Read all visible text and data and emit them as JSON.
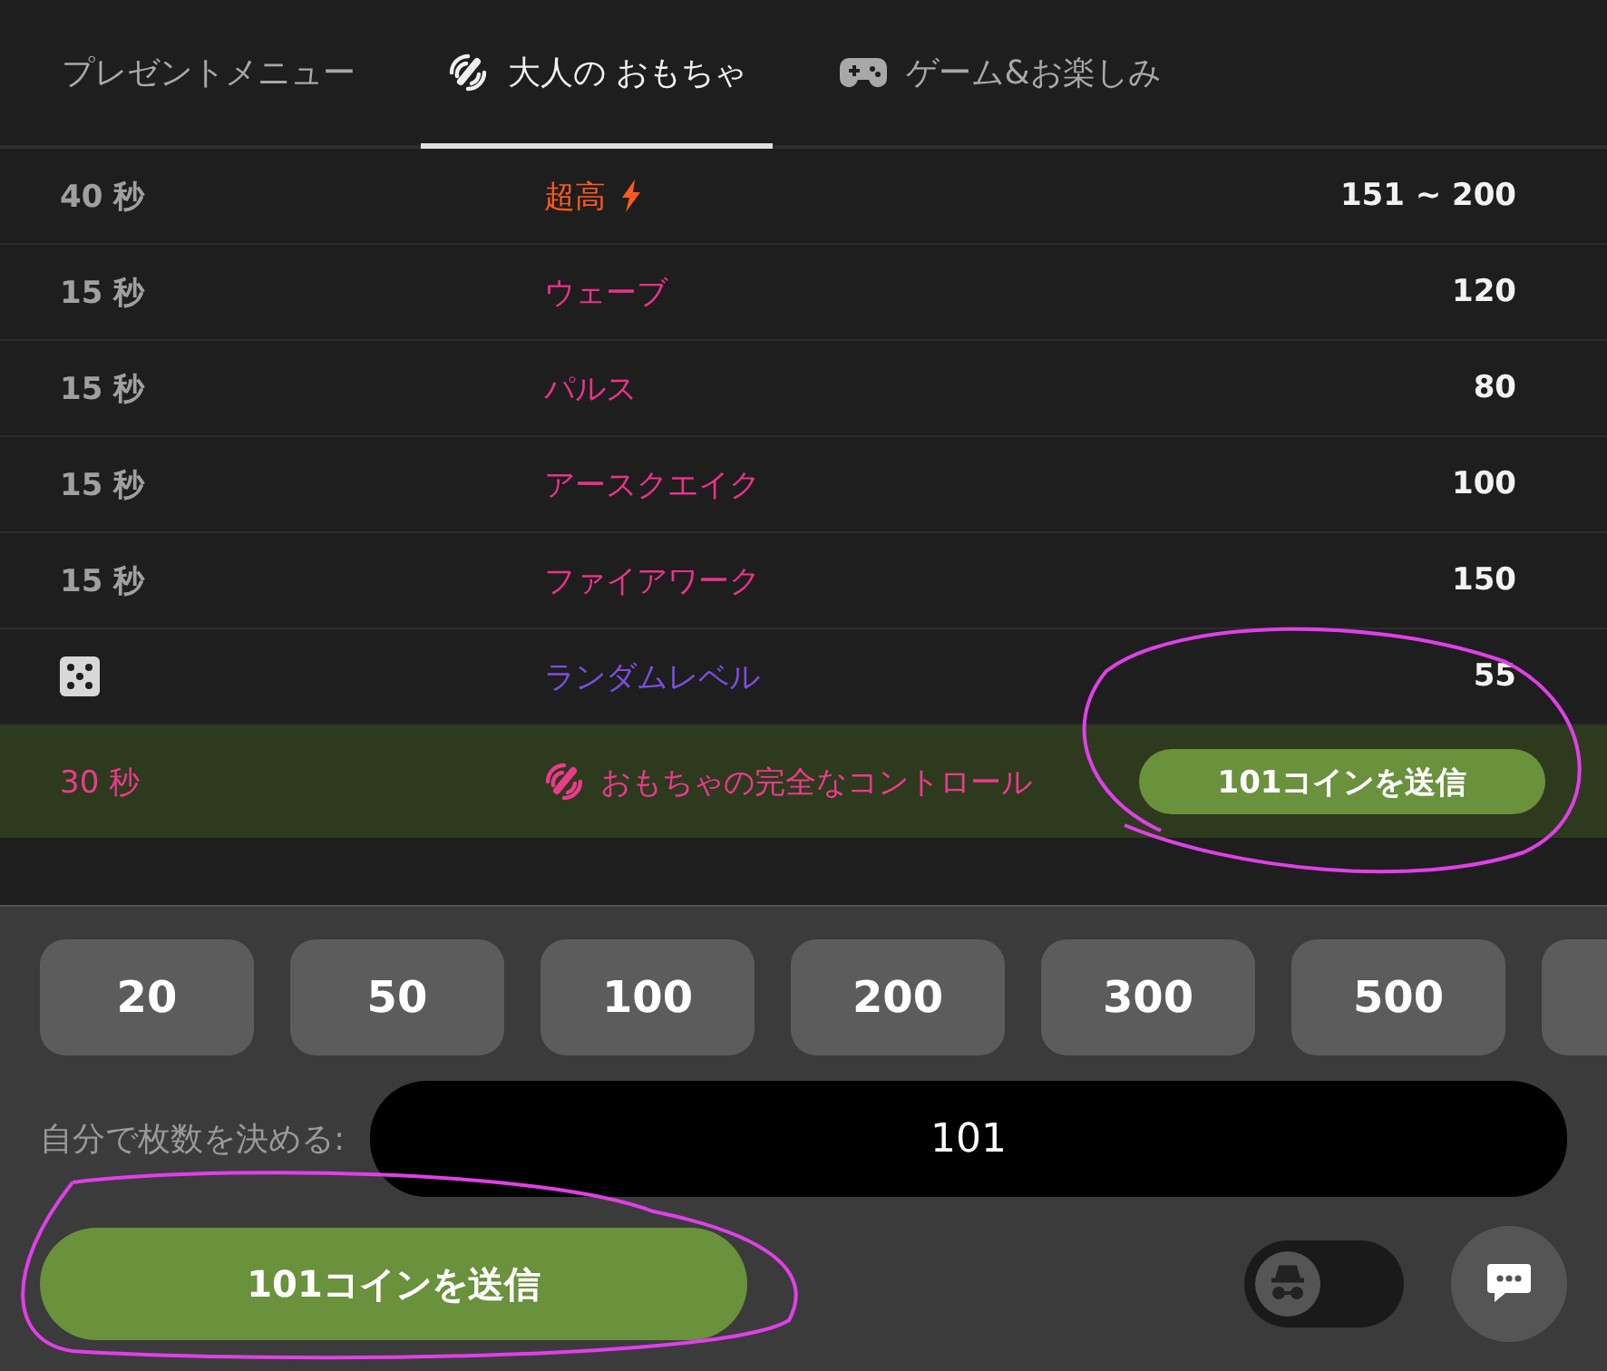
{
  "tabs": [
    {
      "label": "プレゼントメニュー",
      "selected": false
    },
    {
      "label": "大人の おもちゃ",
      "selected": true
    },
    {
      "label": "ゲーム&お楽しみ",
      "selected": false
    }
  ],
  "rows": [
    {
      "kind": "time",
      "time": "40 秒",
      "name": "超高",
      "bolt": true,
      "color": "#ff5a1f",
      "value": "151 ~ 200"
    },
    {
      "kind": "time",
      "time": "15 秒",
      "name": "ウェーブ",
      "bolt": false,
      "color": "#e8338a",
      "value": "120"
    },
    {
      "kind": "time",
      "time": "15 秒",
      "name": "パルス",
      "bolt": false,
      "color": "#e8338a",
      "value": "80"
    },
    {
      "kind": "time",
      "time": "15 秒",
      "name": "アースクエイク",
      "bolt": false,
      "color": "#e8338a",
      "value": "100"
    },
    {
      "kind": "time",
      "time": "15 秒",
      "name": "ファイアワーク",
      "bolt": false,
      "color": "#e8338a",
      "value": "150"
    },
    {
      "kind": "dice",
      "name": "ランダムレベル",
      "bolt": false,
      "color": "#7b4fe0",
      "value": "55"
    }
  ],
  "control_row": {
    "time": "30 秒",
    "name": "おもちゃの完全なコントロール",
    "button": "101コインを送信"
  },
  "amounts": [
    "20",
    "50",
    "100",
    "200",
    "300",
    "500"
  ],
  "custom": {
    "label": "自分で枚数を決める:",
    "value": "101"
  },
  "send_button": "101コインを送信",
  "incognito": {
    "on": false
  }
}
